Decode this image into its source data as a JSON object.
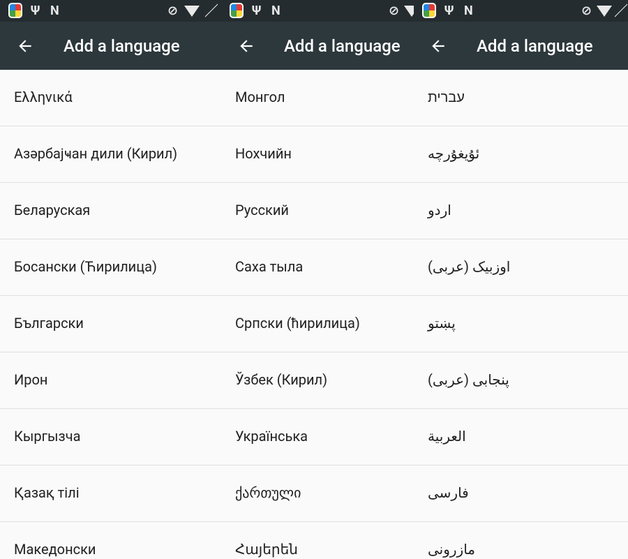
{
  "screen_title": "Add a language",
  "panels": [
    {
      "toolbar": {
        "back_icon": "arrow-left-icon",
        "title": "Add a language"
      },
      "languages": [
        "Ελληνικά",
        "Азәрбајҹан дили (Кирил)",
        "Беларуская",
        "Босански (Ћирилица)",
        "Български",
        "Ирон",
        "Кыргызча",
        "Қазақ тілі",
        "Македонски"
      ]
    },
    {
      "toolbar": {
        "back_icon": "arrow-left-icon",
        "title": "Add a language"
      },
      "languages": [
        "Монгол",
        "Нохчийн",
        "Русский",
        "Саха тыла",
        "Српски (ћирилица)",
        "Ўзбек (Кирил)",
        "Українська",
        "ქართული",
        "Հայերեն"
      ]
    },
    {
      "toolbar": {
        "back_icon": "arrow-left-icon",
        "title": "Add a language"
      },
      "languages": [
        "עברית",
        "ئۇيغۇرچە",
        "اردو",
        "اوزبیک (عربی)",
        "پښتو",
        "پنجابی (عربی)",
        "العربية",
        "فارسی",
        "مازرونی"
      ]
    }
  ],
  "colors": {
    "status_bar": "#242c30",
    "toolbar": "#2d383c",
    "list_background": "#fafafa",
    "divider": "#e0e0e0",
    "text_primary": "#212121",
    "toolbar_text": "#ffffff"
  }
}
